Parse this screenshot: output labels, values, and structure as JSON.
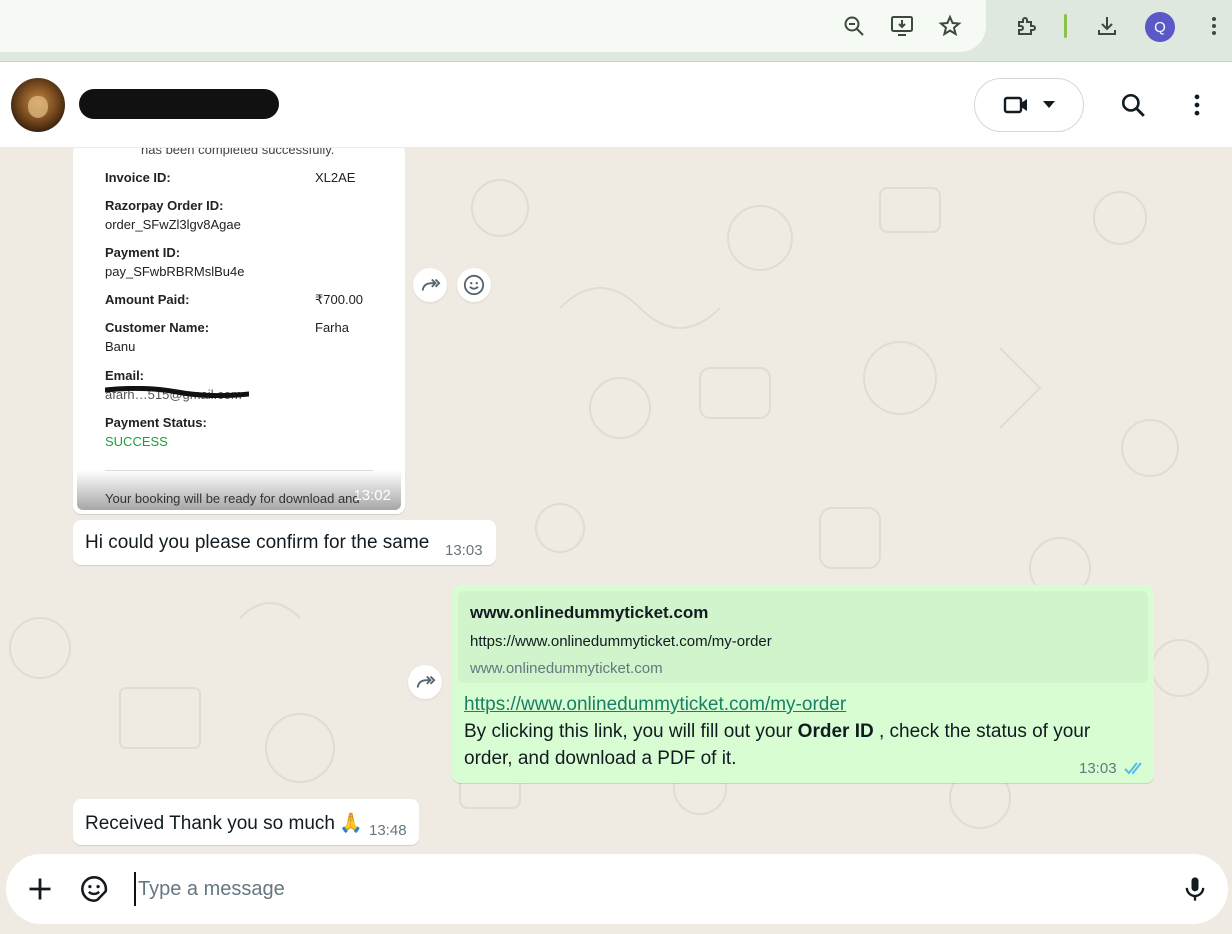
{
  "browser": {
    "icons": [
      "zoom-out-icon",
      "install-app-icon",
      "bookmark-star-icon",
      "extensions-icon",
      "downloads-icon",
      "profile-avatar",
      "menu-kebab-icon"
    ],
    "profile_initial": "Q"
  },
  "header": {
    "contact_avatar": "lion-avatar",
    "contact_name_redacted": true,
    "video_call_icon": "video-call-icon",
    "dropdown_icon": "chevron-down-icon",
    "search_icon": "search-icon",
    "menu_icon": "menu-kebab-icon"
  },
  "receipt": {
    "completed_text": "has been completed successfully.",
    "rows": [
      {
        "label": "Invoice ID:",
        "value": "XL2AE"
      },
      {
        "label": "Razorpay Order ID:",
        "value": "order_SFwZl3lgv8Agae"
      },
      {
        "label": "Payment ID:",
        "value": "pay_SFwbRBRMslBu4e"
      },
      {
        "label": "Amount Paid:",
        "value": "₹700.00"
      },
      {
        "label": "Customer Name:",
        "value": "Farha",
        "value2": "Banu"
      },
      {
        "label": "Email:",
        "value": "afarh…515@gmail.com"
      },
      {
        "label": "Payment Status:",
        "value": "SUCCESS"
      }
    ],
    "footer_text": "Your booking will be ready for download and",
    "time": "13:02"
  },
  "messages": [
    {
      "direction": "in",
      "text": "Hi could you please confirm for the same",
      "time": "13:03"
    },
    {
      "direction": "out",
      "preview": {
        "title": "www.onlinedummyticket.com",
        "description": "https://www.onlinedummyticket.com/my-order",
        "domain": "www.onlinedummyticket.com"
      },
      "link": "https://www.onlinedummyticket.com/my-order",
      "text_before": "By clicking this link, you will fill out your ",
      "text_bold": "Order ID",
      "text_after": " , check the status of your",
      "text_line2": "order, and download a PDF of it.",
      "time": "13:03",
      "status": "read-double-check"
    },
    {
      "direction": "in",
      "text": "Received Thank you so much",
      "emoji": "🙏",
      "time": "13:48"
    }
  ],
  "composer": {
    "placeholder": "Type a message",
    "attach_icon": "plus-icon",
    "sticker_icon": "sticker-icon",
    "mic_icon": "microphone-icon"
  },
  "colors": {
    "chat_background": "#efeae2",
    "outgoing_bubble": "#d9fdd3",
    "incoming_bubble": "#ffffff",
    "read_ticks": "#53bdeb",
    "success_text": "#1e9e3a",
    "profile_badge": "#5b59c7"
  }
}
